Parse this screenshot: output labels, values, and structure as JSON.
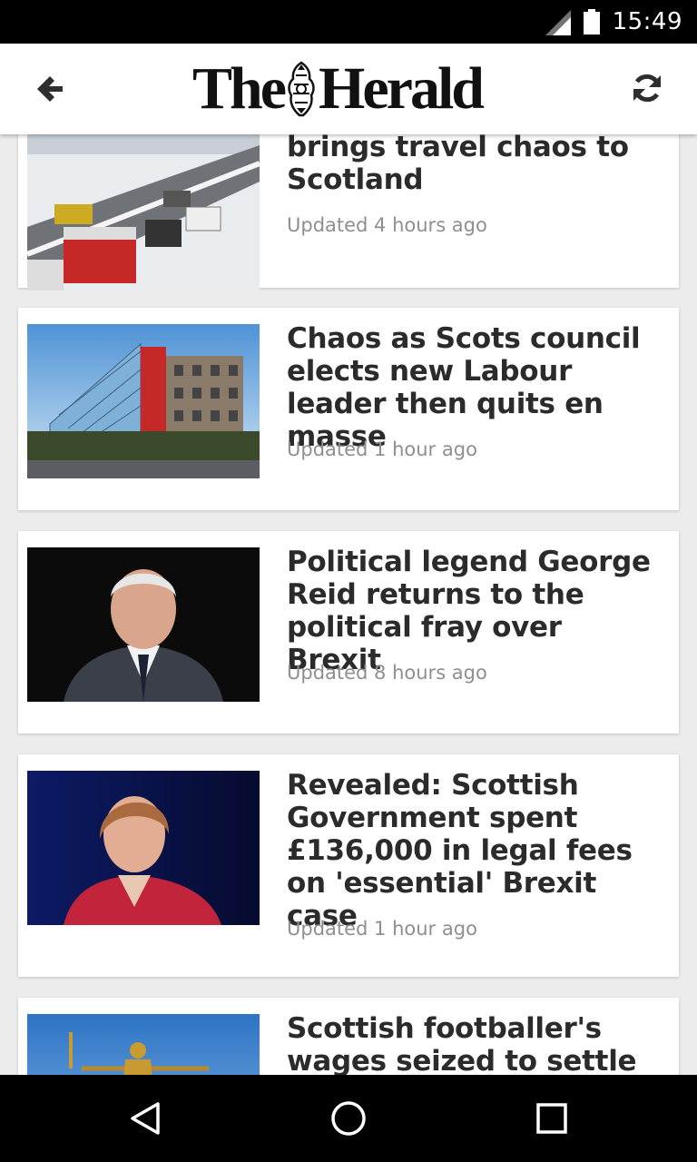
{
  "status_bar": {
    "time": "15:49"
  },
  "app_bar": {
    "logo_left": "The",
    "logo_right": "Herald"
  },
  "articles": [
    {
      "headline": "brings travel chaos to Scotland",
      "updated": "Updated 4 hours ago",
      "image": "snow-traffic"
    },
    {
      "headline": "Chaos as Scots council elects new Labour leader then quits en masse",
      "updated": "Updated 1 hour ago",
      "image": "council-building"
    },
    {
      "headline": "Political legend George Reid returns to the political fray over Brexit",
      "updated": "Updated 8 hours ago",
      "image": "george-reid"
    },
    {
      "headline": "Revealed: Scottish Government spent £136,000 in legal fees on 'essential' Brexit case",
      "updated": "Updated 1 hour ago",
      "image": "politician-red-jacket"
    },
    {
      "headline": "Scottish footballer's wages seized to settle",
      "updated": "",
      "image": "justice-statue"
    }
  ],
  "colors": {
    "background": "#ececec",
    "card": "#ffffff",
    "headline": "#2b2b2b",
    "meta": "#8f8f8f"
  }
}
